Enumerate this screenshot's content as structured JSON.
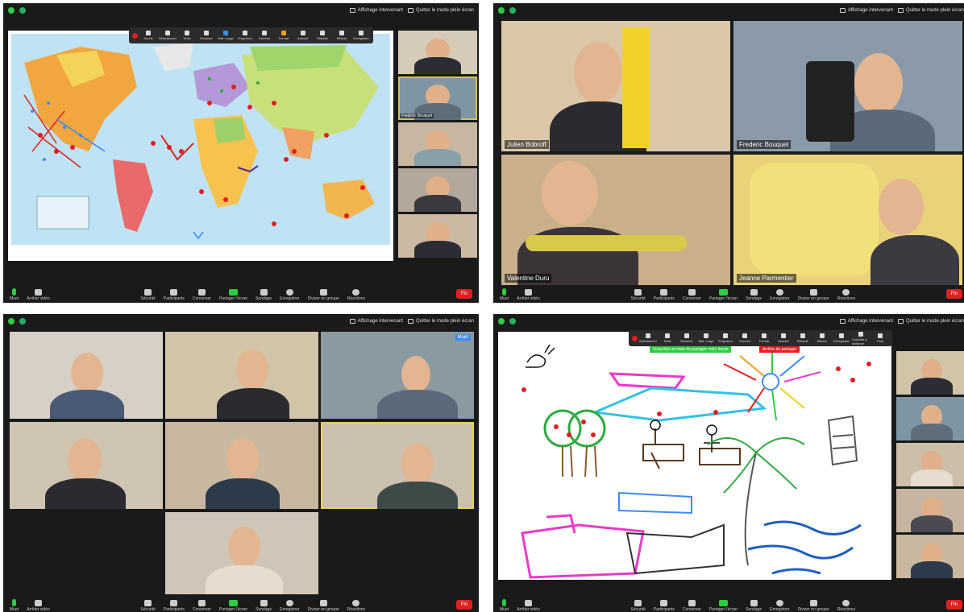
{
  "topbar": {
    "speaker_view": "Affichage intervenant",
    "exit_fullscreen": "Quitter le mode plein écran"
  },
  "bottombar": {
    "mute": "Muet",
    "stop_video": "Arrêter vidéo",
    "security": "Sécurité",
    "participants": "Participants",
    "chat": "Converser",
    "share_screen": "Partager l'écran",
    "poll": "Sondage",
    "record": "Enregistrer",
    "breakout": "Diviser en groupe",
    "reactions": "Réactions",
    "end": "Fin"
  },
  "annotation_toolbar": {
    "items": [
      "Souris",
      "Sélectionner",
      "Texte",
      "Dessiner",
      "Mat. Large",
      "Projecteur",
      "Gomme",
      "Format",
      "Annuler",
      "Rétablir",
      "Effacer",
      "Enregistrer"
    ]
  },
  "panel2": {
    "tiles": [
      {
        "name": "Julien Bobroff",
        "color": "#d9c7a8"
      },
      {
        "name": "Frederic Bouquet",
        "color": "#8a9aa8"
      },
      {
        "name": "Valentine Duru",
        "color": "#c9b08a"
      },
      {
        "name": "Jeanne Parmentier",
        "color": "#e9d27a"
      }
    ]
  },
  "panel1": {
    "thumbs": [
      {
        "name": ""
      },
      {
        "name": "Frederic Bouquet"
      },
      {
        "name": ""
      },
      {
        "name": ""
      },
      {
        "name": ""
      }
    ]
  },
  "panel3": {
    "badge": "Muet"
  },
  "panel4": {
    "sharing_banner": "Vous êtes en train de partager votre écran",
    "stop_share": "Arrêter de partager",
    "extra_toolbar": [
      "Contrôle à distance",
      "Plus"
    ]
  }
}
